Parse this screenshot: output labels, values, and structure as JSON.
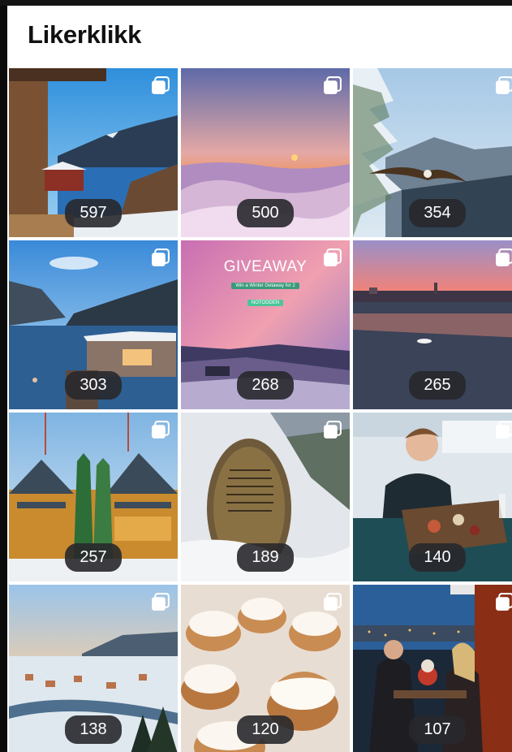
{
  "header": {
    "title": "Likerklikk"
  },
  "posts": [
    {
      "likes": "597",
      "scene": "mountain-fjord-cabin",
      "icon": "multi-image-icon"
    },
    {
      "likes": "500",
      "scene": "sunset-over-clouds",
      "icon": "multi-image-icon"
    },
    {
      "likes": "354",
      "scene": "eagle-snowy-forest",
      "icon": "multi-image-icon"
    },
    {
      "likes": "303",
      "scene": "floating-sauna-fjord",
      "icon": "multi-image-icon"
    },
    {
      "likes": "268",
      "scene": "giveaway-winter-sky",
      "icon": "multi-image-icon",
      "overlay": {
        "heading": "GIVEAWAY",
        "sub": "Win a Winter Getaway for 2",
        "tag": "NOTODDEN"
      }
    },
    {
      "likes": "265",
      "scene": "harbor-sunset-boat",
      "icon": "multi-image-icon"
    },
    {
      "likes": "257",
      "scene": "dragon-style-hotel",
      "icon": "multi-image-icon"
    },
    {
      "likes": "189",
      "scene": "rune-stone-snow",
      "icon": "multi-image-icon"
    },
    {
      "likes": "140",
      "scene": "man-seafood-platter",
      "icon": "multi-image-icon"
    },
    {
      "likes": "138",
      "scene": "snowy-town-river",
      "icon": "multi-image-icon"
    },
    {
      "likes": "120",
      "scene": "cream-buns",
      "icon": "multi-image-icon"
    },
    {
      "likes": "107",
      "scene": "couple-restaurant-night",
      "icon": "multi-image-icon"
    }
  ]
}
